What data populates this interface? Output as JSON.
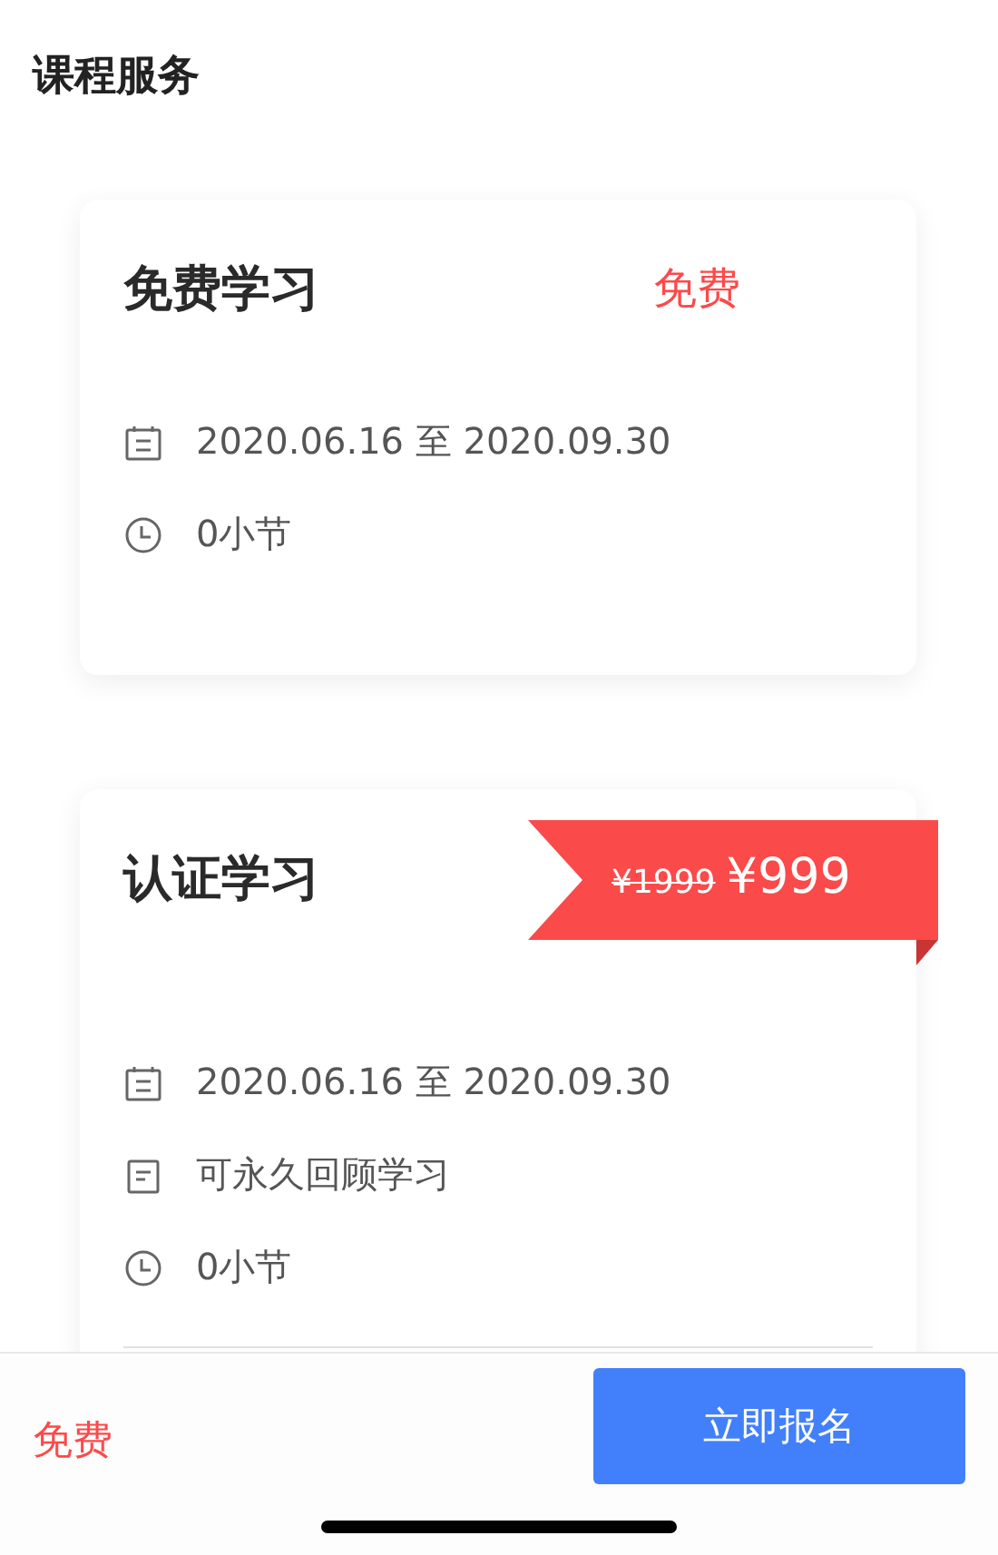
{
  "header": {
    "title": "课程服务"
  },
  "plans": [
    {
      "name": "免费学习",
      "price": {
        "kind": "free",
        "text": "免费"
      },
      "details": [
        {
          "kind": "date",
          "text": "2020.06.16 至 2020.09.30"
        },
        {
          "kind": "lessons",
          "text": "0小节"
        }
      ],
      "divider": false
    },
    {
      "name": "认证学习",
      "price": {
        "kind": "ribbon",
        "original": "¥1999",
        "text": "¥999"
      },
      "details": [
        {
          "kind": "date",
          "text": "2020.06.16 至 2020.09.30"
        },
        {
          "kind": "replay",
          "text": "可永久回顾学习"
        },
        {
          "kind": "lessons",
          "text": "0小节"
        }
      ],
      "divider": true
    }
  ],
  "footer": {
    "price": "免费",
    "button": "立即报名"
  }
}
